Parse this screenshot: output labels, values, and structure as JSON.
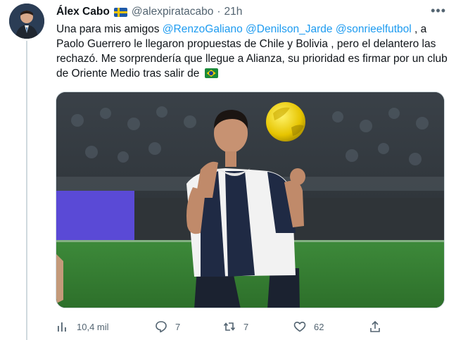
{
  "tweet": {
    "author_name": "Álex Cabo",
    "author_handle": "@alexpiratacabo",
    "separator": "·",
    "time": "21h",
    "text": {
      "intro": "Una para mis amigos ",
      "mention_1": "@RenzoGaliano",
      "mention_2": "@Denilson_Jarde",
      "mention_3": "@sonrieelfutbol",
      "body": " , a Paolo Guerrero le llegaron propuestas de Chile y Bolivia , pero el delantero las rechazó. Me sorprendería que llegue a Alianza, su prioridad es firmar por un club de Oriente Medio tras salir de "
    },
    "flags": [
      "sweden-flag",
      "brazil-flag"
    ],
    "media_description_icon": "photo-football-player"
  },
  "actions": {
    "views": "10,4 mil",
    "replies": "7",
    "retweets": "7",
    "likes": "62"
  },
  "colors": {
    "accent": "#1d9bf0",
    "secondary_text": "#536471",
    "primary_text": "#0f1419",
    "divider": "#cfd9de"
  }
}
